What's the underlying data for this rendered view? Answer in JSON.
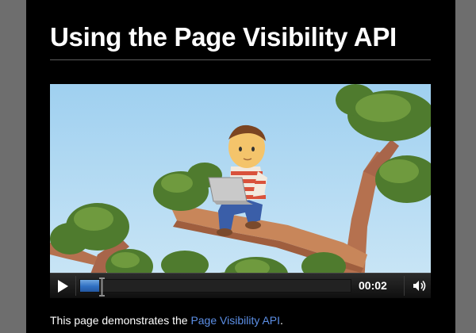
{
  "page": {
    "title": "Using the Page Visibility API"
  },
  "player": {
    "time": "00:02",
    "progress_fraction": 0.07,
    "icons": {
      "play": "play-icon",
      "volume": "volume-icon"
    },
    "colors": {
      "progress": "#2f6fc2",
      "controls_bg": "#1a1a1a"
    }
  },
  "caption": {
    "prefix": "This page demonstrates the ",
    "link_text": "Page Visibility API",
    "suffix": ".",
    "link_color": "#5c8fe6"
  }
}
